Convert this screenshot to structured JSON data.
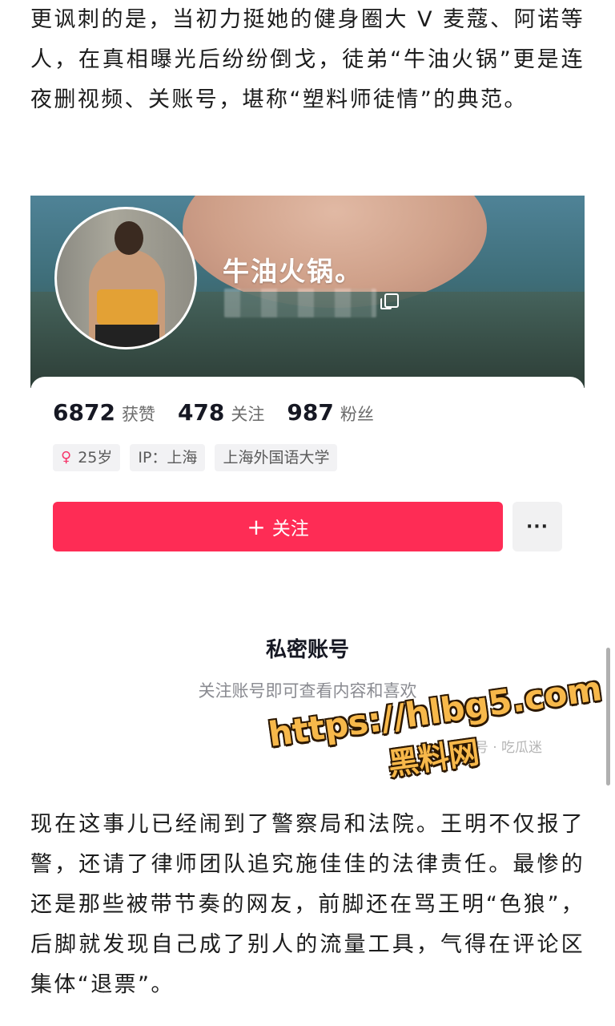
{
  "article": {
    "paragraph_1": "更讽刺的是，当初力挺她的健身圈大 V 麦蔻、阿诺等人，在真相曝光后纷纷倒戈，徒弟“牛油火锅”更是连夜删视频、关账号，堪称“塑料师徒情”的典范。",
    "paragraph_2": "现在这事儿已经闹到了警察局和法院。王明不仅报了警，还请了律师团队追究施佳佳的法律责任。最惨的还是那些被带节奏的网友，前脚还在骂王明“色狼”，后脚就发现自己成了别人的流量工具，气得在评论区集体“退票”。"
  },
  "profile": {
    "username": "牛油火锅。",
    "stats": [
      {
        "value": "6872",
        "label": "获赞"
      },
      {
        "value": "478",
        "label": "关注"
      },
      {
        "value": "987",
        "label": "粉丝"
      }
    ],
    "tags": {
      "age": "25岁",
      "ip": "IP：上海",
      "school": "上海外国语大学"
    },
    "follow_label": "关注",
    "follow_plus": "+",
    "more_label": "···",
    "private_title": "私密账号",
    "private_subtitle": "关注账号即可查看内容和喜欢",
    "credit": "公众号 · 吃瓜迷"
  },
  "watermark": {
    "url": "https://hlbg5.com",
    "name": "黑料网"
  },
  "colors": {
    "follow_button": "#fe2c55",
    "watermark_fill": "#f7b84a",
    "female_icon": "#f6356a"
  },
  "icons": [
    "female-icon",
    "copy-icon",
    "more-icon",
    "plus-icon",
    "wechat-icon"
  ]
}
